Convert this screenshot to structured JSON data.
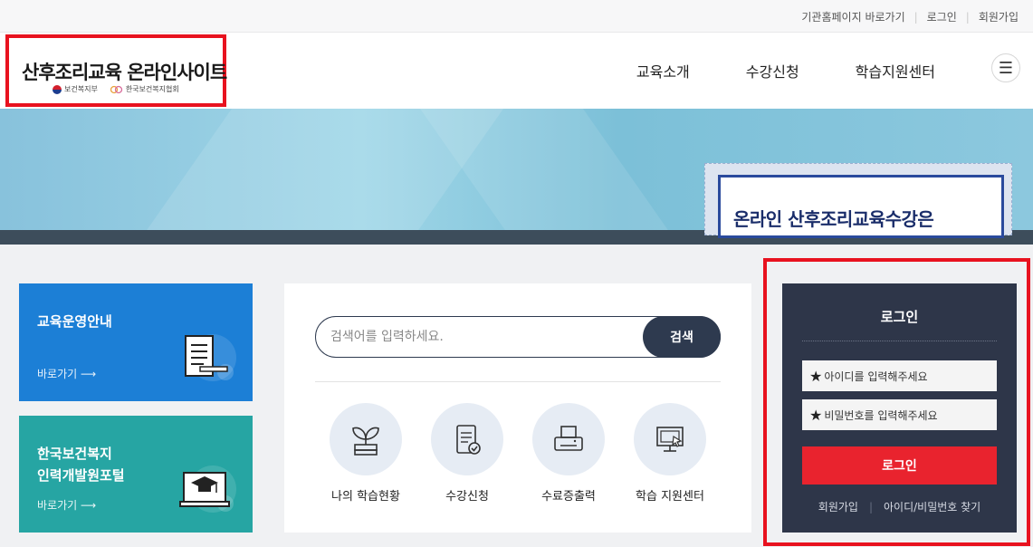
{
  "util": {
    "links": [
      "기관홈페이지 바로가기",
      "로그인",
      "회원가입"
    ]
  },
  "header": {
    "logo_title": "산후조리교육 온라인사이트",
    "logo_sub_1": "보건복지부",
    "logo_sub_2": "한국보건복지협회",
    "nav": [
      "교육소개",
      "수강신청",
      "학습지원센터"
    ],
    "menu_icon": "hamburger-icon"
  },
  "banner": {
    "promo_text": "온라인 산후조리교육수강은"
  },
  "cards": [
    {
      "title": "교육운영안내",
      "link": "바로가기 ⟶",
      "color": "#1c7fd6"
    },
    {
      "title_line1": "한국보건복지",
      "title_line2": "인력개발원포털",
      "link": "바로가기 ⟶",
      "color": "#26a5a3"
    }
  ],
  "search": {
    "placeholder": "검색어를 입력하세요.",
    "button": "검색"
  },
  "quick_links": [
    {
      "label": "나의 학습현황",
      "icon": "plant-icon"
    },
    {
      "label": "수강신청",
      "icon": "clipboard-check-icon"
    },
    {
      "label": "수료증출력",
      "icon": "printer-icon"
    },
    {
      "label": "학습 지원센터",
      "icon": "monitor-cursor-icon"
    }
  ],
  "login": {
    "title": "로그인",
    "id_placeholder": "아이디를 입력해주세요",
    "pw_placeholder": "비밀번호를 입력해주세요",
    "button": "로그인",
    "join": "회원가입",
    "find": "아이디/비밀번호 찾기"
  },
  "colors": {
    "login_button": "#e9232e",
    "login_panel": "#2e3649",
    "highlight_border": "#e8121f"
  }
}
